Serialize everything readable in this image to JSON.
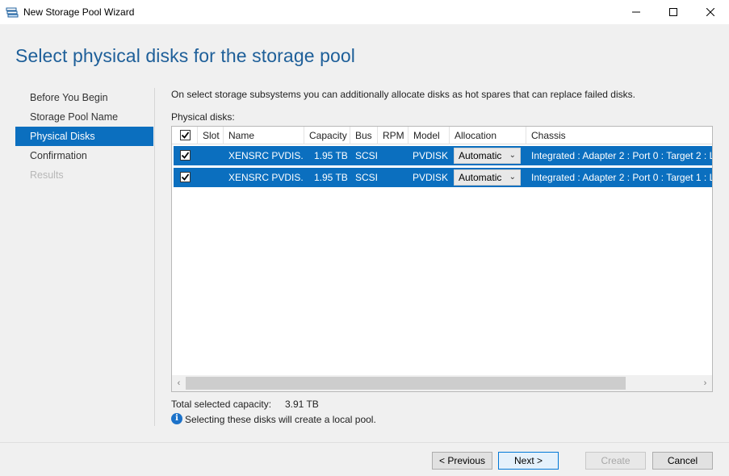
{
  "window": {
    "title": "New Storage Pool Wizard",
    "icon": "storage-pool-icon"
  },
  "page": {
    "title": "Select physical disks for the storage pool",
    "description": "On select storage subsystems you can additionally allocate disks as hot spares that can replace failed disks.",
    "disks_label": "Physical disks:"
  },
  "nav": {
    "items": [
      {
        "label": "Before You Begin",
        "state": "normal"
      },
      {
        "label": "Storage Pool Name",
        "state": "normal"
      },
      {
        "label": "Physical Disks",
        "state": "active"
      },
      {
        "label": "Confirmation",
        "state": "normal"
      },
      {
        "label": "Results",
        "state": "disabled"
      }
    ]
  },
  "table": {
    "columns": [
      "Slot",
      "Name",
      "Capacity",
      "Bus",
      "RPM",
      "Model",
      "Allocation",
      "Chassis"
    ],
    "rows": [
      {
        "checked": true,
        "slot": "",
        "name": "XENSRC PVDIS...",
        "capacity": "1.95 TB",
        "bus": "SCSI",
        "rpm": "",
        "model": "PVDISK",
        "allocation": "Automatic",
        "chassis": "Integrated : Adapter 2 : Port 0 : Target 2 : L"
      },
      {
        "checked": true,
        "slot": "",
        "name": "XENSRC PVDIS...",
        "capacity": "1.95 TB",
        "bus": "SCSI",
        "rpm": "",
        "model": "PVDISK",
        "allocation": "Automatic",
        "chassis": "Integrated : Adapter 2 : Port 0 : Target 1 : L"
      }
    ]
  },
  "summary": {
    "total_label": "Total selected capacity:",
    "total_value": "3.91 TB",
    "info_text": "Selecting these disks will create a local pool."
  },
  "buttons": {
    "previous": "< Previous",
    "next": "Next >",
    "create": "Create",
    "cancel": "Cancel"
  },
  "colors": {
    "accent": "#0b6fbf",
    "title": "#1e5f99"
  }
}
